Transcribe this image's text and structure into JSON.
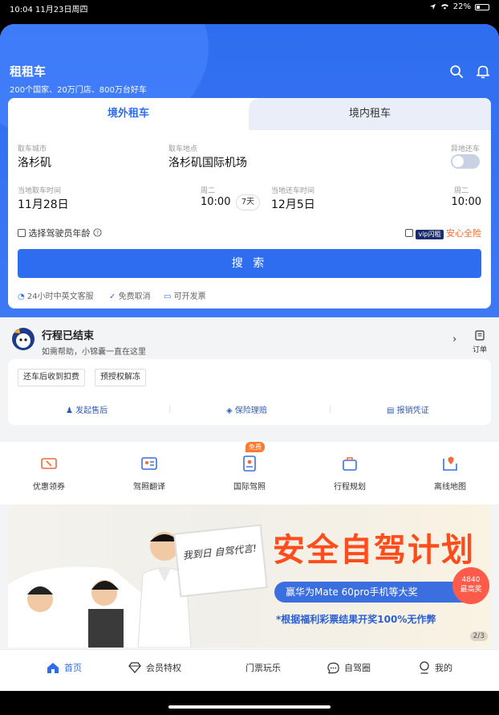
{
  "status": {
    "time": "10:04",
    "date": "11月23日周四",
    "battery": "22%"
  },
  "header": {
    "title": "租租车",
    "subtitle": "200个国家、20万门店、800万台好车"
  },
  "search": {
    "tabs": [
      "境外租车",
      "境内租车"
    ],
    "pickup_city_label": "取车城市",
    "pickup_city": "洛杉矶",
    "pickup_location_label": "取车地点",
    "pickup_location": "洛杉矶国际机场",
    "diff_return_label": "异地还车",
    "pickup_time_label": "当地取车时间",
    "pickup_date": "11月28日",
    "pickup_weekday": "周二",
    "pickup_time": "10:00",
    "days": "7天",
    "return_time_label": "当地还车时间",
    "return_date": "12月5日",
    "return_weekday": "周二",
    "return_time": "10:00",
    "driver_age": "选择驾驶员年龄",
    "vip_tag": "vip闪租",
    "safe_full": "安心全险",
    "button": "搜 索",
    "features": [
      "24小时中英文客服",
      "免费取消",
      "可开发票"
    ]
  },
  "trip": {
    "title": "行程已结束",
    "subtitle": "如需帮助，小锦囊一直在这里",
    "orders": "订单",
    "tags": [
      "还车后收到扣费",
      "预授权解冻"
    ],
    "links": [
      "发起售后",
      "保险理赔",
      "报销凭证"
    ]
  },
  "quick": {
    "items": [
      "优惠领券",
      "驾照翻译",
      "国际驾照",
      "行程规划",
      "离线地图"
    ],
    "badge": "免费"
  },
  "banner": {
    "title": "安全自驾计划",
    "board": "我到日 自驾代言!",
    "pill": "赢华为Mate 60pro手机等大奖",
    "note": "*根据福利彩票结果开奖100%无作弊",
    "prize_amount": "4840",
    "prize_label": "最高奖",
    "pager": "2/3"
  },
  "tabbar": [
    "首页",
    "会员特权",
    "门票玩乐",
    "自驾圈",
    "我的"
  ],
  "colors": {
    "primary": "#2f6df0",
    "accent": "#ff4c1c",
    "badge": "#ff7a2f"
  }
}
